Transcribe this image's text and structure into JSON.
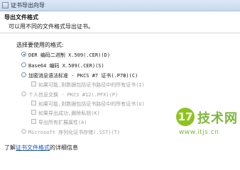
{
  "window": {
    "title": "证书导出向导"
  },
  "header": {
    "heading": "导出文件格式",
    "subheading": "可以用不同的文件格式导出证书。"
  },
  "format_prompt": "选择要使用的格式:",
  "options": {
    "der": {
      "label": "DER 编码二进制 X.509(.CER)(D)",
      "selected": true
    },
    "base64": {
      "label": "Base64 编码 X.509(.CER)(S)",
      "selected": false
    },
    "pkcs7": {
      "label": "加密消息语法标准 - PKCS #7 证书(.P7B)(C)",
      "selected": false,
      "include_all": "如果可能,则数据包括证书路径中的所有证书(I)"
    },
    "pfx": {
      "label": "个人信息交换 - PKCS #12(.PFX)(P)",
      "selected": false,
      "include_all": "如果可能,则数据包括证书路径中的所有证书(U)",
      "delete_key": "如果导出成功,删除私钥(K)",
      "export_extended": "导出所有扩展属性(A)"
    },
    "sst": {
      "label": "Microsoft 序列化证书存储(.SST)(T)",
      "selected": false
    }
  },
  "footer": {
    "prefix": "了解",
    "link": "证书文件格式",
    "suffix": "的详细信息"
  },
  "watermark": {
    "glyph": "17",
    "text": "技术网",
    "url": "www.itjs.cn"
  },
  "colors": {
    "titlebar": "#c9daee",
    "link": "#1a56b4",
    "watermark": "#7db73b"
  }
}
